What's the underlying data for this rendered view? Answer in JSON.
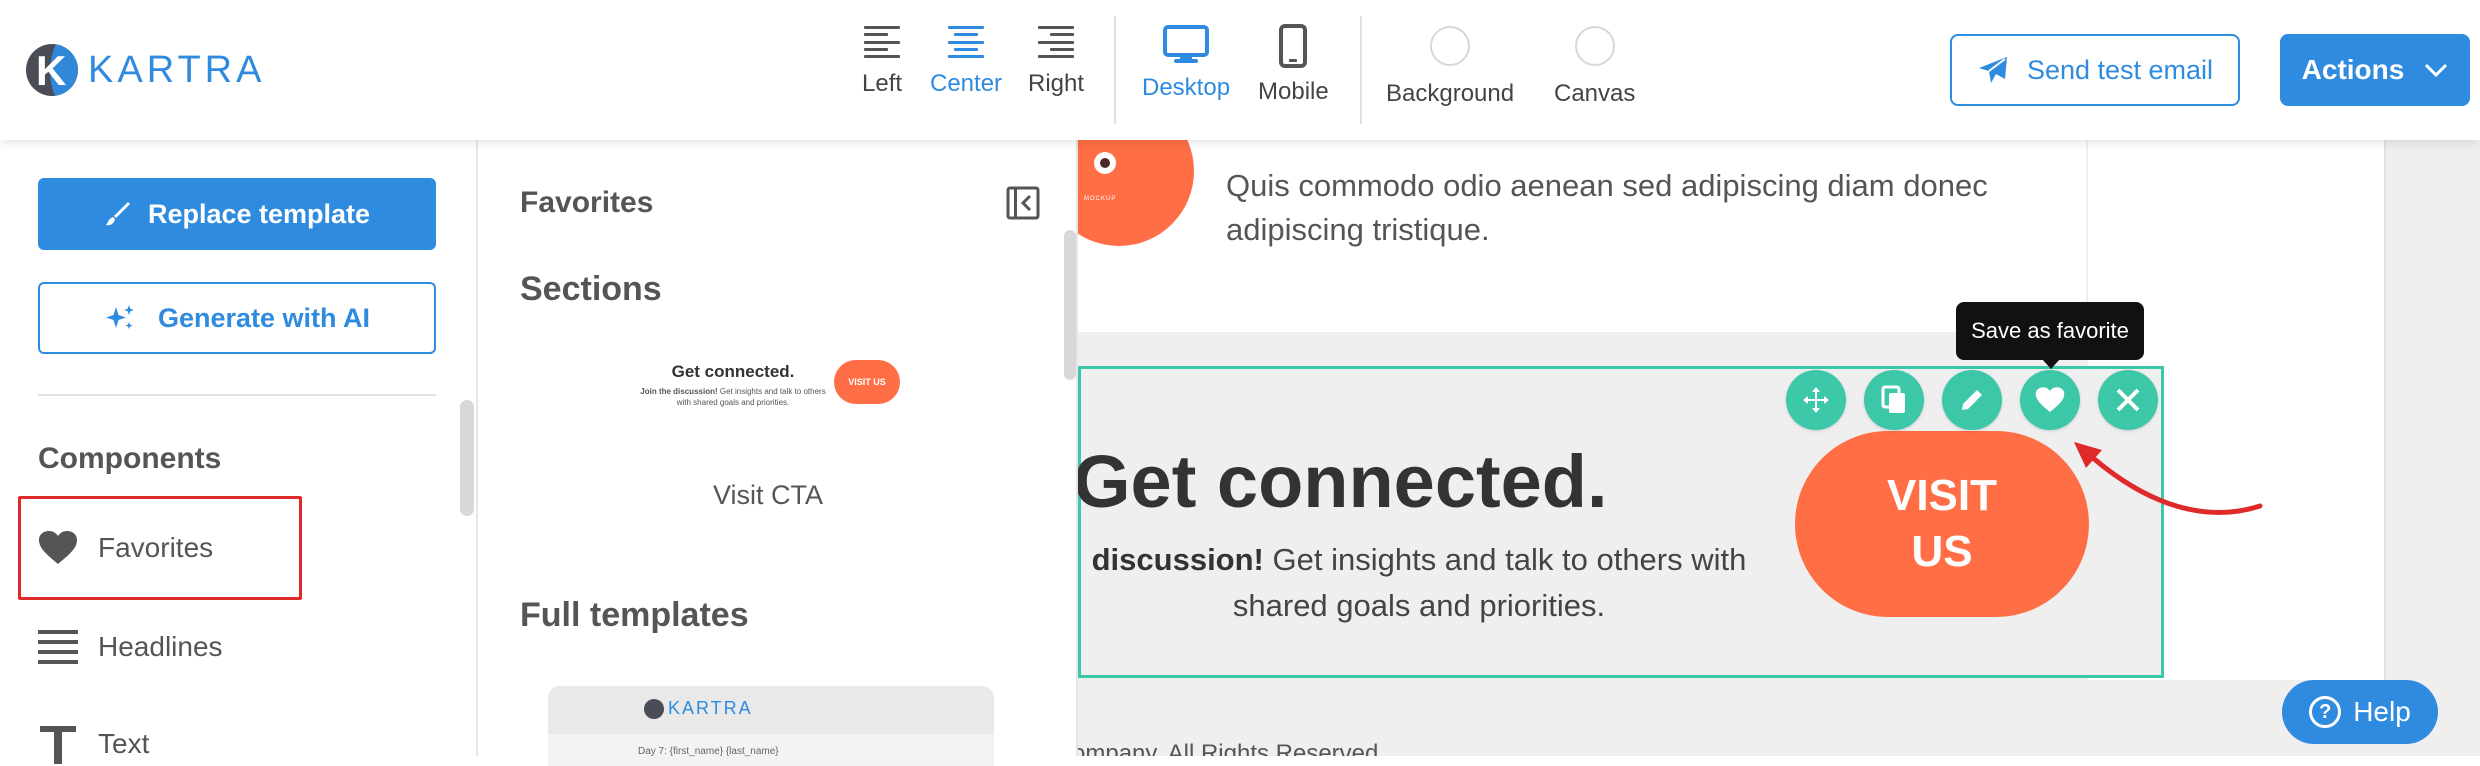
{
  "brand": {
    "name": "KARTRA",
    "accent": "#2f8be0",
    "teal": "#3cc7a8",
    "cta_orange": "#ff6e44",
    "highlight_red": "#e02a2a"
  },
  "toolbar": {
    "align": {
      "left": "Left",
      "center": "Center",
      "right": "Right",
      "active": "center"
    },
    "device": {
      "desktop": "Desktop",
      "mobile": "Mobile",
      "active": "desktop"
    },
    "background_label": "Background",
    "canvas_label": "Canvas",
    "send_test": "Send test email",
    "actions": "Actions"
  },
  "sidebar": {
    "replace_template": "Replace template",
    "generate_ai": "Generate with AI",
    "components_title": "Components",
    "items": [
      {
        "label": "Favorites",
        "icon": "heart-icon"
      },
      {
        "label": "Headlines",
        "icon": "headlines-icon"
      },
      {
        "label": "Text",
        "icon": "text-icon"
      }
    ]
  },
  "panel": {
    "title": "Favorites",
    "sections_title": "Sections",
    "cta_thumb": {
      "title": "Get connected.",
      "sub_bold": "Join the discussion!",
      "sub_rest": "Get insights and talk to others with shared goals and priorities.",
      "button": "VISIT US"
    },
    "cta_caption": "Visit CTA",
    "templates_title": "Full templates",
    "template_thumb": {
      "logo": "KARTRA",
      "line": "Day 7: {first_name} {last_name}"
    }
  },
  "canvas": {
    "top_card_text": "Quis commodo odio aenean sed adipiscing diam donec adipiscing tristique.",
    "cta_title": "Get connected.",
    "cta_sub_bold": "discussion!",
    "cta_sub_rest": " Get insights and talk to others with shared goals and priorities.",
    "visit_button": "VISIT US",
    "tooltip": "Save as favorite",
    "footer": "ompany. All Rights Reserved."
  },
  "help": "Help"
}
